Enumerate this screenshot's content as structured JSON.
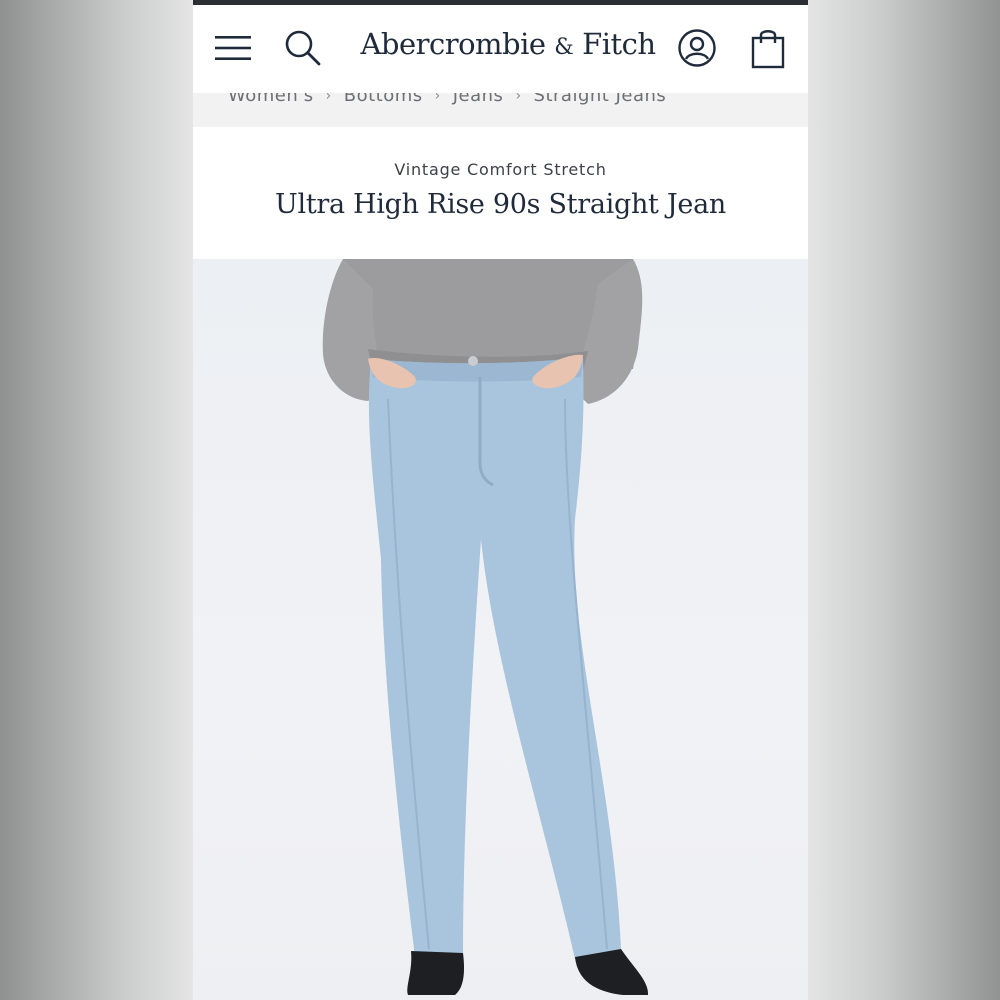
{
  "header": {
    "brand_main": "Abercrombie",
    "brand_amp": "&",
    "brand_end": "Fitch"
  },
  "breadcrumb": [
    "Women's",
    "Bottoms",
    "Jeans",
    "Straight Jeans"
  ],
  "product": {
    "collection": "Vintage Comfort Stretch",
    "title": "Ultra High Rise 90s Straight Jean"
  },
  "icons": {
    "menu": "hamburger-menu-icon",
    "search": "search-icon",
    "account": "account-icon",
    "bag": "shopping-bag-icon"
  },
  "colors": {
    "brand_navy": "#1f2a3a",
    "denim": "#a9c4dd",
    "sweater": "#9a9a9c"
  }
}
